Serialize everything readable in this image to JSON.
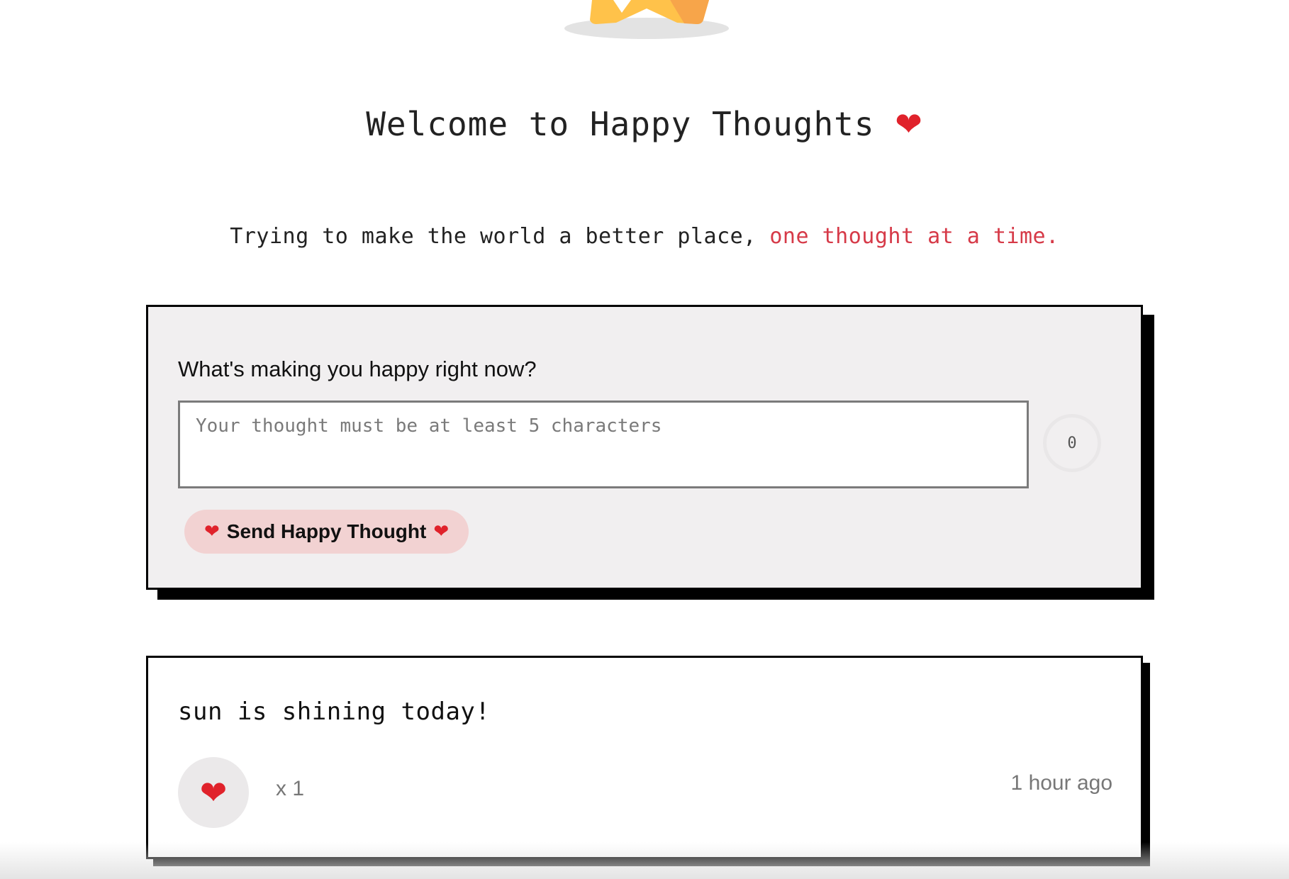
{
  "header": {
    "logo_icon": "star-logo-icon",
    "title": "Welcome to Happy Thoughts",
    "title_icon": "heart-icon",
    "tagline_main": "Trying to make the world a better place, ",
    "tagline_accent": "one thought at a time."
  },
  "form": {
    "question": "What's making you happy right now?",
    "input_value": "",
    "input_placeholder": "Your thought must be at least 5 characters",
    "char_count": "0",
    "send_label": "Send Happy Thought"
  },
  "thoughts": [
    {
      "message": "sun is shining today!",
      "likes": "x 1",
      "time": "1 hour ago"
    }
  ],
  "colors": {
    "accent": "#d63a48",
    "form_bg": "#f1eff0",
    "send_button_bg": "#f2d2d2",
    "heart": "#e0222b"
  }
}
